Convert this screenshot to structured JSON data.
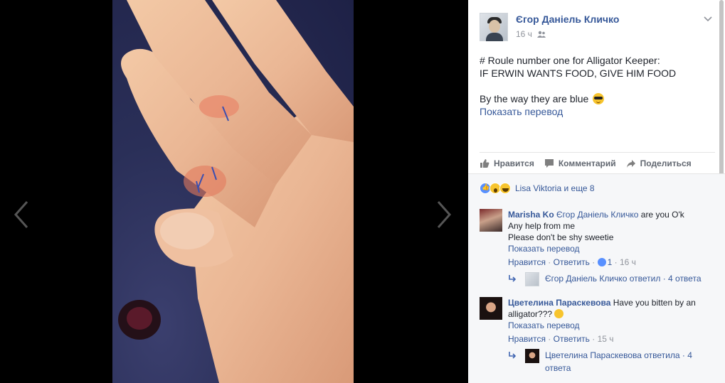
{
  "post": {
    "author": "Єгор Даніель Кличко",
    "time": "16 ч",
    "body_line1": "# Roule number one for Alligator Keeper:",
    "body_line2": "IF ERWIN WANTS FOOD, GIVE HIM FOOD",
    "body_line3": "By the way they are blue",
    "translate": "Показать перевод"
  },
  "actions": {
    "like": "Нравится",
    "comment": "Комментарий",
    "share": "Поделиться"
  },
  "reactions": {
    "summary": "Lisa Viktoria и еще 8"
  },
  "comments": [
    {
      "author": "Marisha Ko",
      "mention": "Єгор Даніель Кличко",
      "text1": "are you O'k",
      "text2": "Any help from me",
      "text3": "Please don't be shy sweetie",
      "translate": "Показать перевод",
      "like": "Нравится",
      "reply": "Ответить",
      "likes_count": "1",
      "time": "16 ч",
      "replies_author": "Єгор Даніель Кличко",
      "replies_label": "ответил · 4 ответа"
    },
    {
      "author": "Цветелина Параскевова",
      "text1": "Have you bitten by an",
      "text2": "alligator???",
      "translate": "Показать перевод",
      "like": "Нравится",
      "reply": "Ответить",
      "time": "15 ч",
      "replies_author": "Цветелина Параскевова",
      "replies_label": "ответила · 4",
      "replies_label2": "ответа"
    }
  ],
  "colors": {
    "link": "#365899",
    "muted": "#90949c",
    "panel_bg": "#ffffff",
    "comments_bg": "#f6f7f9"
  }
}
